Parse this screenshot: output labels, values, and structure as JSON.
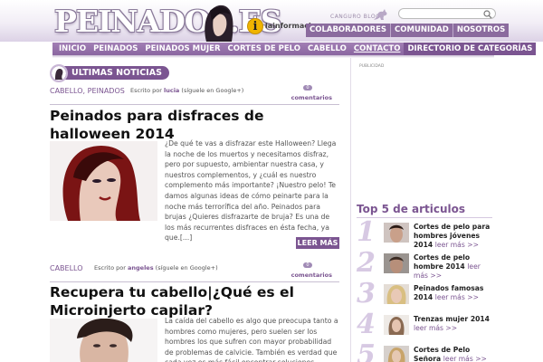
{
  "header": {
    "logo": "PEINADOS.ES",
    "info_badge": "i",
    "info_label": "lainformacion.com",
    "cangu_label": "CANGURO BLOGS",
    "search_placeholder": "",
    "top_nav": [
      "COLABORADORES",
      "COMUNIDAD",
      "NOSOTROS"
    ]
  },
  "main_nav": {
    "items": [
      "INICIO",
      "PEINADOS",
      "PEINADOS MUJER",
      "CORTES DE PELO",
      "CABELLO",
      "CONTACTO",
      "DIRECTORIO DE CATEGORÍAS"
    ],
    "active_index": 5
  },
  "section": {
    "label": "ULTIMAS NOTICIAS"
  },
  "posts": [
    {
      "categories": "CABELLO, PEINADOS",
      "byline_prefix": "Escrito por",
      "author": "lucia",
      "byline_suffix": "(síguele en Google+)",
      "comment_count": "0",
      "comments_label": "comentarios",
      "title": "Peinados para disfraces de halloween 2014",
      "excerpt": "¿De qué te vas a disfrazar este Halloween? Llega la noche de los muertos y necesitamos disfraz, pero por supuesto, ambientar nuestra casa, y nuestros complementos, y ¿cuál es nuestro complemento más importante? ¡Nuestro pelo! Te damos algunas ideas de cómo peinarte para la noche más terrorífica del año. Peinados para brujas ¿Quieres disfrazarte de bruja? Es una de los más recurrentes disfraces en ésta fecha, ya que.[...]",
      "more_label": "LEER MÁS"
    },
    {
      "categories": "CABELLO",
      "byline_prefix": "Escrito por",
      "author": "angeles",
      "byline_suffix": "(síguele en Google+)",
      "comment_count": "0",
      "comments_label": "comentarios",
      "title": "Recupera tu cabello|¿Qué es el Microinjerto capilar?",
      "excerpt": "La caída del cabello es algo que preocupa tanto a hombres como mujeres, pero suelen ser los hombres los que sufren con mayor probabilidad de problemas de calvicie. También es verdad que cada vez es más fácil encontrar soluciones prácticas y"
    }
  ],
  "sidebar": {
    "ad_label": "PUBLICIDAD",
    "top5_title": "Top 5 de articulos",
    "more_label": "leer más >>",
    "items": [
      {
        "num": "1",
        "title": "Cortes de pelo para hombres jóvenes 2014"
      },
      {
        "num": "2",
        "title": "Cortes de pelo hombre 2014"
      },
      {
        "num": "3",
        "title": "Peinados famosas 2014"
      },
      {
        "num": "4",
        "title": "Trenzas mujer 2014"
      },
      {
        "num": "5",
        "title": "Cortes de Pelo Señora"
      }
    ]
  },
  "colors": {
    "brand_purple": "#7b5591",
    "nav_purple": "#8a66a0",
    "accent_gold": "#f0b400"
  }
}
